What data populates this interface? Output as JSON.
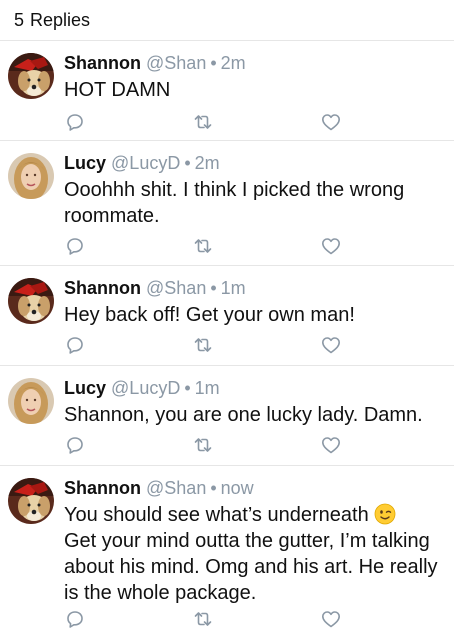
{
  "header": {
    "count": "5",
    "label": "Replies"
  },
  "colors": {
    "meta_gray": "#8b98a5",
    "text": "#111111",
    "divider": "#e6e6e6",
    "icon_gray": "#8b98a5"
  },
  "replies": [
    {
      "name": "Shannon",
      "handle": "@Shan",
      "separator": "•",
      "time": "2m",
      "text": "HOT DAMN",
      "avatar": "dog-avatar"
    },
    {
      "name": "Lucy",
      "handle": "@LucyD",
      "separator": "•",
      "time": "2m",
      "text": "Ooohhh shit. I think I picked the wrong roommate.",
      "avatar": "woman-avatar"
    },
    {
      "name": "Shannon",
      "handle": "@Shan",
      "separator": "•",
      "time": "1m",
      "text": "Hey back off! Get your own man!",
      "avatar": "dog-avatar"
    },
    {
      "name": "Lucy",
      "handle": "@LucyD",
      "separator": "•",
      "time": "1m",
      "text": "Shannon, you are one lucky lady. Damn.",
      "avatar": "woman-avatar"
    },
    {
      "name": "Shannon",
      "handle": "@Shan",
      "separator": "•",
      "time": "now",
      "text": "You should see what’s underneath",
      "text_cont": "Get your mind outta the gutter, I’m talking about his mind. Omg and his art. He really is the whole package.",
      "emoji": "winking-face",
      "avatar": "dog-avatar"
    }
  ],
  "icons": {
    "reply": "reply-icon",
    "retweet": "retweet-icon",
    "like": "heart-icon"
  }
}
